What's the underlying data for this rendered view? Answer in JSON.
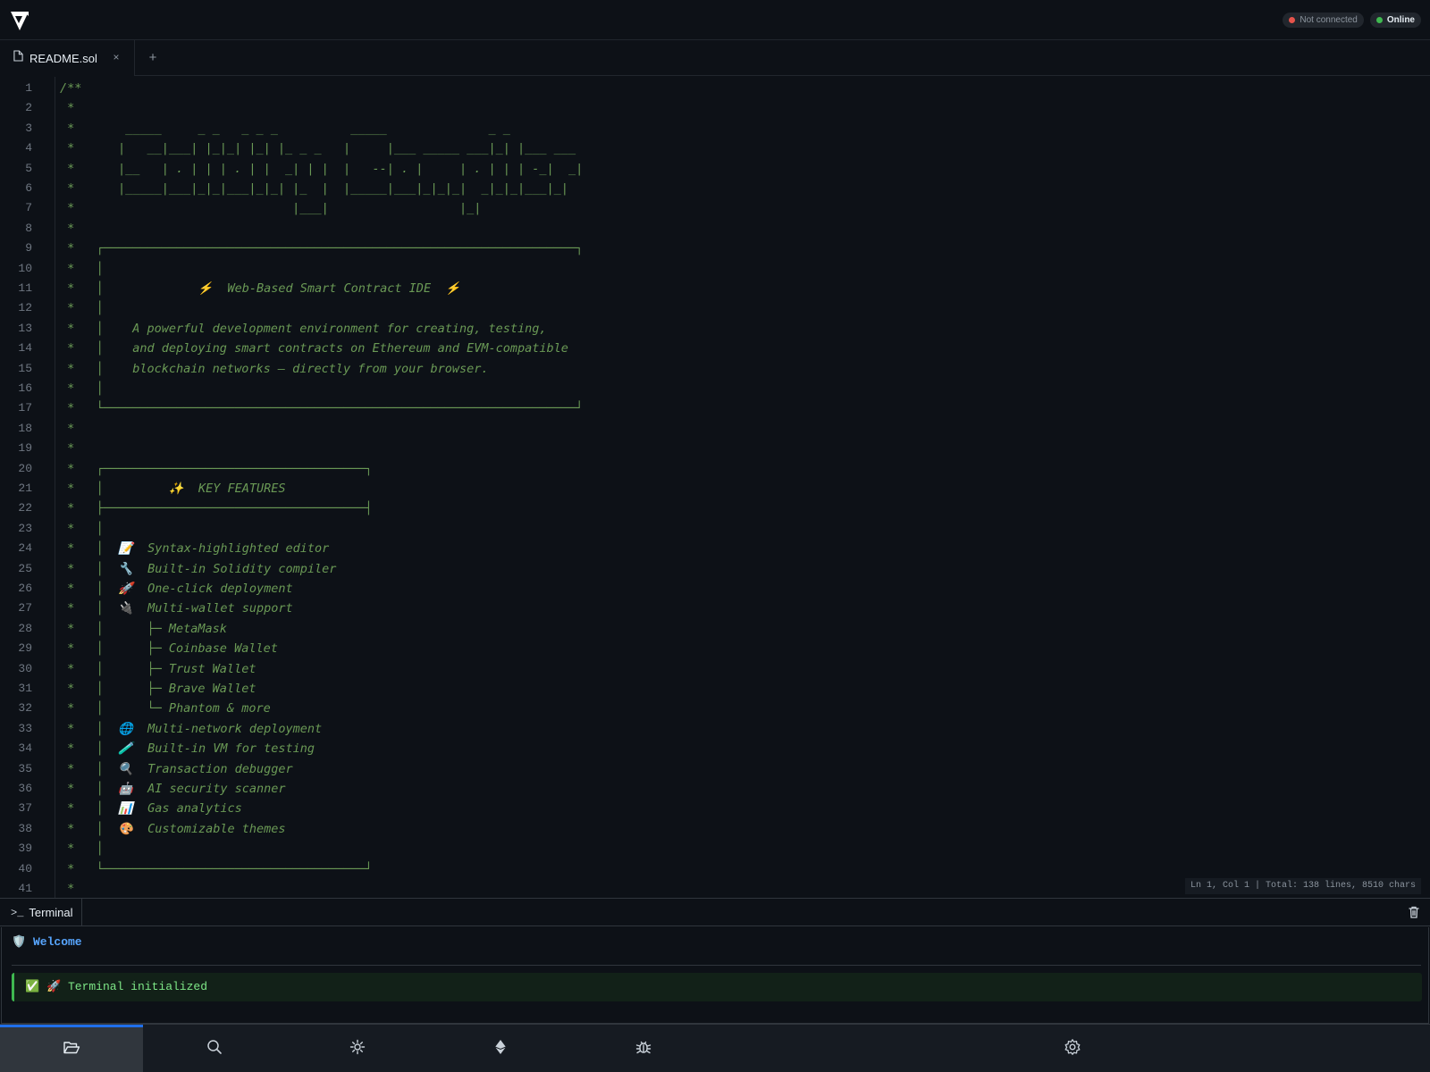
{
  "header": {
    "logo_icon": "remix-logo-icon",
    "status": [
      {
        "label": "Not connected",
        "color": "#e5534b"
      },
      {
        "label": "Online",
        "color": "#3fb950"
      }
    ]
  },
  "tabs": {
    "items": [
      {
        "label": "README.sol",
        "icon": "file-icon",
        "close": "×"
      }
    ],
    "add_label": "+"
  },
  "editor": {
    "line_numbers": [
      "1",
      "2",
      "3",
      "4",
      "5",
      "6",
      "7",
      "8",
      "9",
      "10",
      "11",
      "12",
      "13",
      "14",
      "15",
      "16",
      "17",
      "18",
      "19",
      "20",
      "21",
      "22",
      "23",
      "24",
      "25",
      "26",
      "27",
      "28",
      "29",
      "30",
      "31",
      "32",
      "33",
      "34",
      "35",
      "36",
      "37",
      "38",
      "39",
      "40",
      "41"
    ],
    "lines": [
      "/**",
      " *",
      " *       _____     _ _   _ _ _          _____              _ _",
      " *      |   __|___| |_|_| |_| |_ _ _   |     |___ _____ ___|_| |___ ___",
      " *      |__   | . | | | . | |  _| | |  |   --| . |     | . | | | -_|  _|",
      " *      |_____|___|_|_|___|_|_| |_  |  |_____|___|_|_|_|  _|_|_|___|_|",
      " *                              |___|                  |_|",
      " *",
      " *   ┌─────────────────────────────────────────────────────────────────┐",
      " *   │",
      " *   │             ⚡  Web-Based Smart Contract IDE  ⚡",
      " *   │",
      " *   │    A powerful development environment for creating, testing,",
      " *   │    and deploying smart contracts on Ethereum and EVM-compatible",
      " *   │    blockchain networks — directly from your browser.",
      " *   │",
      " *   └─────────────────────────────────────────────────────────────────┘",
      " *",
      " *",
      " *   ┌────────────────────────────────────┐",
      " *   │         ✨  KEY FEATURES",
      " *   ├────────────────────────────────────┤",
      " *   │",
      " *   │  📝  Syntax-highlighted editor",
      " *   │  🔧  Built-in Solidity compiler",
      " *   │  🚀  One-click deployment",
      " *   │  🔌  Multi-wallet support",
      " *   │      ├─ MetaMask",
      " *   │      ├─ Coinbase Wallet",
      " *   │      ├─ Trust Wallet",
      " *   │      ├─ Brave Wallet",
      " *   │      └─ Phantom & more",
      " *   │  🌐  Multi-network deployment",
      " *   │  🧪  Built-in VM for testing",
      " *   │  🔍  Transaction debugger",
      " *   │  🤖  AI security scanner",
      " *   │  📊  Gas analytics",
      " *   │  🎨  Customizable themes",
      " *   │",
      " *   └────────────────────────────────────┘",
      " *"
    ],
    "status": "Ln 1, Col 1 | Total: 138 lines, 8510 chars"
  },
  "terminal": {
    "tab_label": "Terminal",
    "prompt_glyph": ">_",
    "welcome_emoji": "🛡️",
    "welcome": "Welcome",
    "message": "✅  🚀 Terminal initialized",
    "clear_icon": "trash-icon"
  },
  "bottom_nav": [
    {
      "name": "files-nav-button",
      "icon": "folder-open-icon",
      "active": true
    },
    {
      "name": "search-nav-button",
      "icon": "search-icon",
      "active": false
    },
    {
      "name": "compiler-nav-button",
      "icon": "compile-icon",
      "active": false
    },
    {
      "name": "deploy-nav-button",
      "icon": "ethereum-icon",
      "active": false
    },
    {
      "name": "debugger-nav-button",
      "icon": "bug-icon",
      "active": false
    },
    {
      "name": "settings-nav-button",
      "icon": "gear-icon",
      "active": false
    }
  ]
}
